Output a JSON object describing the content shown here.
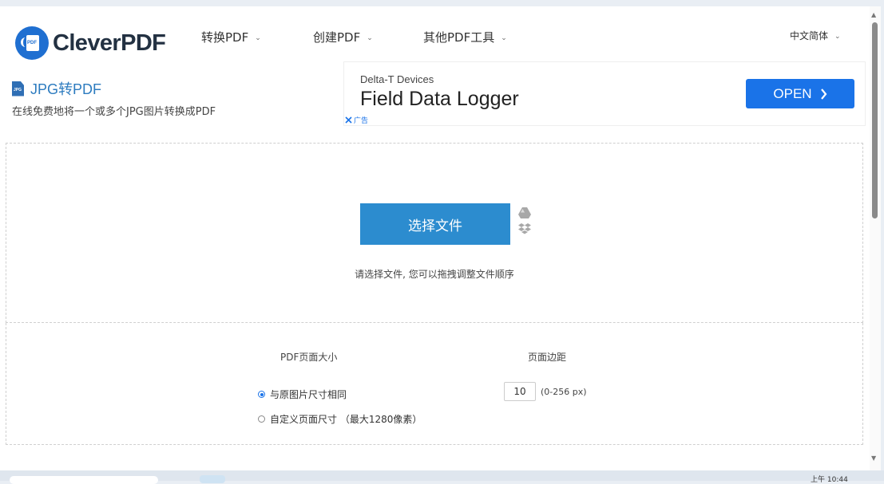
{
  "header": {
    "logo_text": "CleverPDF",
    "logo_badge": "PDF",
    "nav": [
      "转换PDF",
      "创建PDF",
      "其他PDF工具"
    ],
    "language": "中文简体"
  },
  "page": {
    "file_badge": "JPG",
    "title": "JPG转PDF",
    "subtitle": "在线免费地将一个或多个JPG图片转换成PDF"
  },
  "ad": {
    "advertiser": "Delta-T Devices",
    "headline": "Field Data Logger",
    "cta": "OPEN",
    "label": "广告"
  },
  "upload": {
    "choose_button": "选择文件",
    "hint": "请选择文件, 您可以拖拽调整文件顺序",
    "cloud_icons": [
      "google-drive-icon",
      "dropbox-icon"
    ]
  },
  "options": {
    "page_size_heading": "PDF页面大小",
    "margin_heading": "页面边距",
    "radio_same": "与原图片尺寸相同",
    "radio_custom": "自定义页面尺寸 （最大1280像素）",
    "margin_value": "10",
    "margin_range": "(0-256 px)"
  },
  "taskbar": {
    "clock": "上午 10:44"
  },
  "colors": {
    "accent": "#2c8ccf",
    "title_blue": "#2c7bbf",
    "ad_button": "#1a73e8"
  }
}
